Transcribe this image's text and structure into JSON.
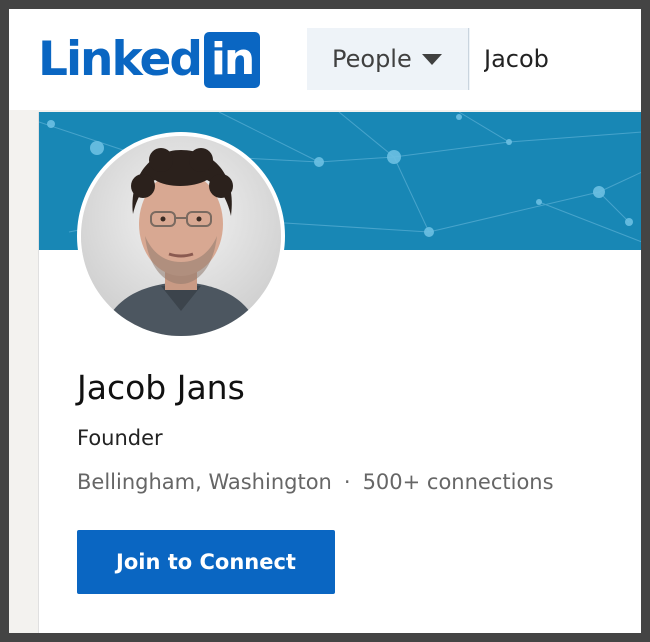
{
  "brand": {
    "logo_text": "Linked",
    "logo_box_text": "in",
    "accent_color": "#0a66c2"
  },
  "search": {
    "category_label": "People",
    "query_value": "Jacob"
  },
  "profile": {
    "name": "Jacob Jans",
    "headline": "Founder",
    "location": "Bellingham, Washington",
    "separator": "·",
    "connections": "500+ connections",
    "connect_button_label": "Join to Connect",
    "banner_color": "#1887b5"
  }
}
